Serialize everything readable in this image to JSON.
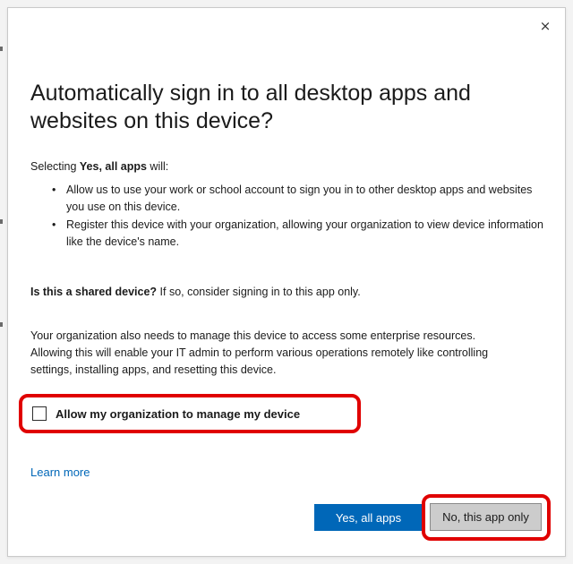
{
  "dialog": {
    "close_glyph": "×",
    "title": "Automatically sign in to all desktop apps and websites on this device?",
    "intro_prefix": "Selecting ",
    "intro_bold": "Yes, all apps",
    "intro_suffix": " will:",
    "bullet_glyph": "•",
    "bullets": [
      "Allow us to use your work or school account to sign you in to other desktop apps and websites you use on this device.",
      "Register this device with your organization, allowing your organization to view device information like the device's name."
    ],
    "shared_question": "Is this a shared device?",
    "shared_rest": " If so, consider signing in to this app only.",
    "manage_text": "Your organization also needs to manage this device to access some enterprise resources. Allowing this will enable your IT admin to perform various operations remotely like controlling settings, installing apps, and resetting this device.",
    "checkbox": {
      "label": "Allow my organization to manage my device",
      "checked": false
    },
    "learn_more": "Learn more",
    "primary_button": "Yes, all apps",
    "secondary_button": "No, this app only"
  },
  "colors": {
    "accent": "#0067b8",
    "highlight": "#e00000",
    "secondary_button_bg": "#cccccc"
  },
  "icons": {
    "close": "close-icon"
  }
}
